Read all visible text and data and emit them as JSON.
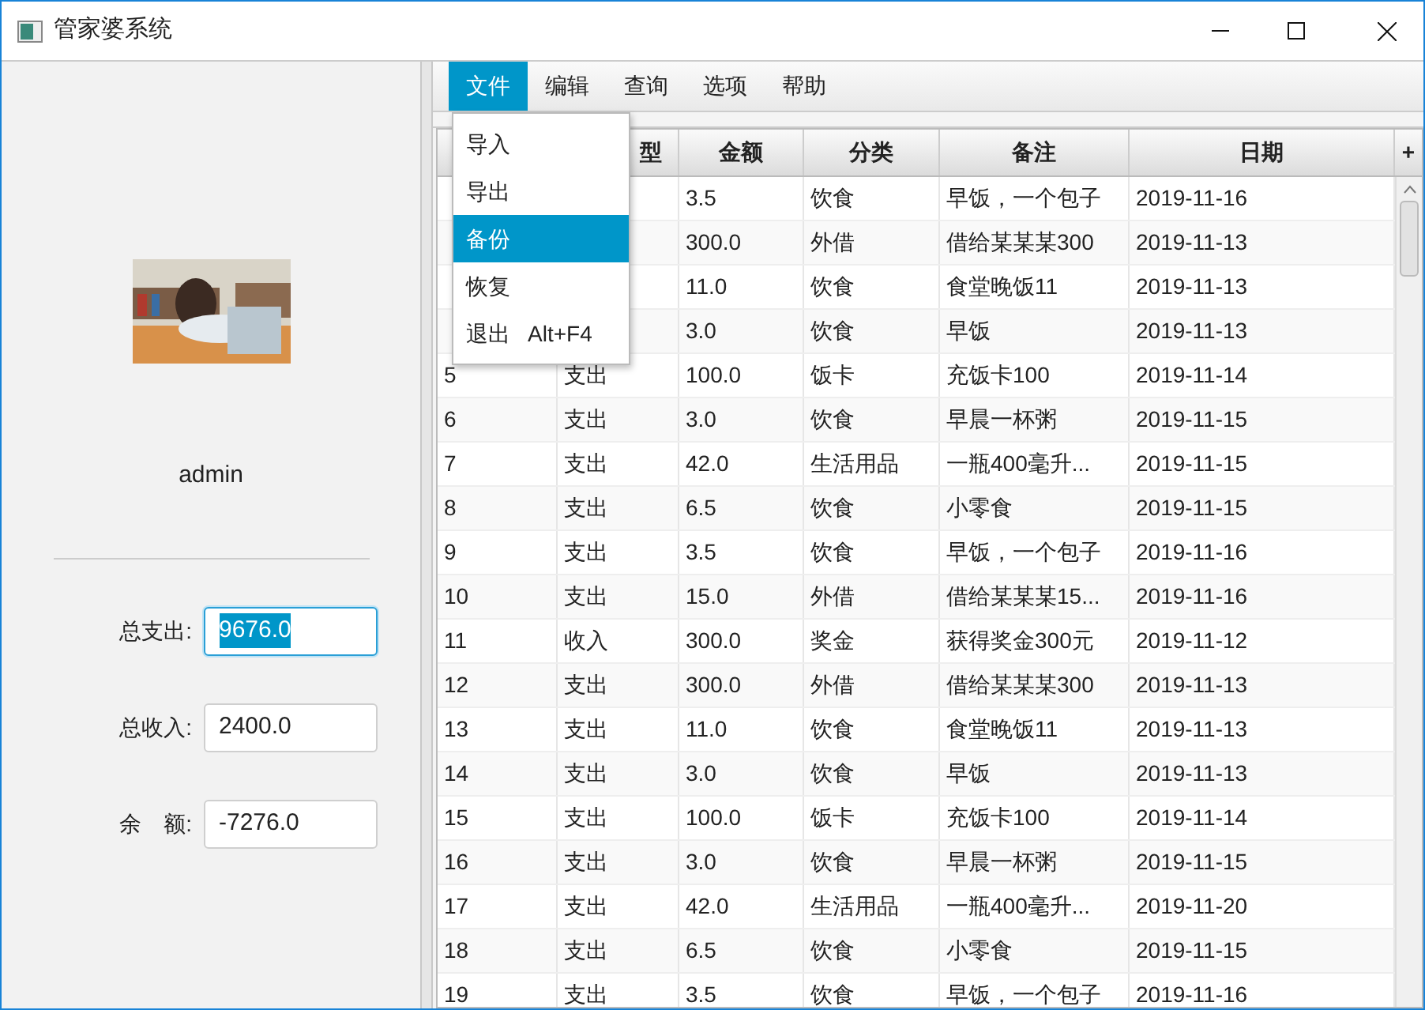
{
  "window": {
    "title": "管家婆系统"
  },
  "user": {
    "name": "admin"
  },
  "summary": [
    {
      "label": "总支出:",
      "value": "9676.0",
      "focused": true
    },
    {
      "label": "总收入:",
      "value": "2400.0",
      "focused": false
    },
    {
      "label": "余　额:",
      "value": "-7276.0",
      "focused": false
    }
  ],
  "menu_bar": [
    {
      "label": "文件",
      "selected": true
    },
    {
      "label": "编辑",
      "selected": false
    },
    {
      "label": "查询",
      "selected": false
    },
    {
      "label": "选项",
      "selected": false
    },
    {
      "label": "帮助",
      "selected": false
    }
  ],
  "file_menu": [
    {
      "label": "导入",
      "selected": false
    },
    {
      "label": "导出",
      "selected": false
    },
    {
      "label": "备份",
      "selected": true
    },
    {
      "label": "恢复",
      "selected": false
    },
    {
      "label": "退出",
      "shortcut": "Alt+F4",
      "selected": false
    }
  ],
  "table": {
    "columns": [
      "型",
      "金额",
      "分类",
      "备注",
      "日期"
    ],
    "add_column": "+",
    "rows": [
      {
        "amount": "3.5",
        "category": "饮食",
        "note": "早饭，一个包子",
        "date": "2019-11-16"
      },
      {
        "amount": "300.0",
        "category": "外借",
        "note": "借给某某某300",
        "date": "2019-11-13"
      },
      {
        "amount": "11.0",
        "category": "饮食",
        "note": "食堂晚饭11",
        "date": "2019-11-13"
      },
      {
        "amount": "3.0",
        "category": "饮食",
        "note": "早饭",
        "date": "2019-11-13"
      },
      {
        "id": "5",
        "type": "支出",
        "amount": "100.0",
        "category": "饭卡",
        "note": "充饭卡100",
        "date": "2019-11-14"
      },
      {
        "id": "6",
        "type": "支出",
        "amount": "3.0",
        "category": "饮食",
        "note": "早晨一杯粥",
        "date": "2019-11-15"
      },
      {
        "id": "7",
        "type": "支出",
        "amount": "42.0",
        "category": "生活用品",
        "note": "一瓶400毫升...",
        "date": "2019-11-15"
      },
      {
        "id": "8",
        "type": "支出",
        "amount": "6.5",
        "category": "饮食",
        "note": "小零食",
        "date": "2019-11-15"
      },
      {
        "id": "9",
        "type": "支出",
        "amount": "3.5",
        "category": "饮食",
        "note": "早饭，一个包子",
        "date": "2019-11-16"
      },
      {
        "id": "10",
        "type": "支出",
        "amount": "15.0",
        "category": "外借",
        "note": "借给某某某15...",
        "date": "2019-11-16"
      },
      {
        "id": "11",
        "type": "收入",
        "amount": "300.0",
        "category": "奖金",
        "note": "获得奖金300元",
        "date": "2019-11-12"
      },
      {
        "id": "12",
        "type": "支出",
        "amount": "300.0",
        "category": "外借",
        "note": "借给某某某300",
        "date": "2019-11-13"
      },
      {
        "id": "13",
        "type": "支出",
        "amount": "11.0",
        "category": "饮食",
        "note": "食堂晚饭11",
        "date": "2019-11-13"
      },
      {
        "id": "14",
        "type": "支出",
        "amount": "3.0",
        "category": "饮食",
        "note": "早饭",
        "date": "2019-11-13"
      },
      {
        "id": "15",
        "type": "支出",
        "amount": "100.0",
        "category": "饭卡",
        "note": "充饭卡100",
        "date": "2019-11-14"
      },
      {
        "id": "16",
        "type": "支出",
        "amount": "3.0",
        "category": "饮食",
        "note": "早晨一杯粥",
        "date": "2019-11-15"
      },
      {
        "id": "17",
        "type": "支出",
        "amount": "42.0",
        "category": "生活用品",
        "note": "一瓶400毫升...",
        "date": "2019-11-20"
      },
      {
        "id": "18",
        "type": "支出",
        "amount": "6.5",
        "category": "饮食",
        "note": "小零食",
        "date": "2019-11-15"
      },
      {
        "id": "19",
        "type": "支出",
        "amount": "3.5",
        "category": "饮食",
        "note": "早饭，一个包子",
        "date": "2019-11-16"
      }
    ]
  }
}
